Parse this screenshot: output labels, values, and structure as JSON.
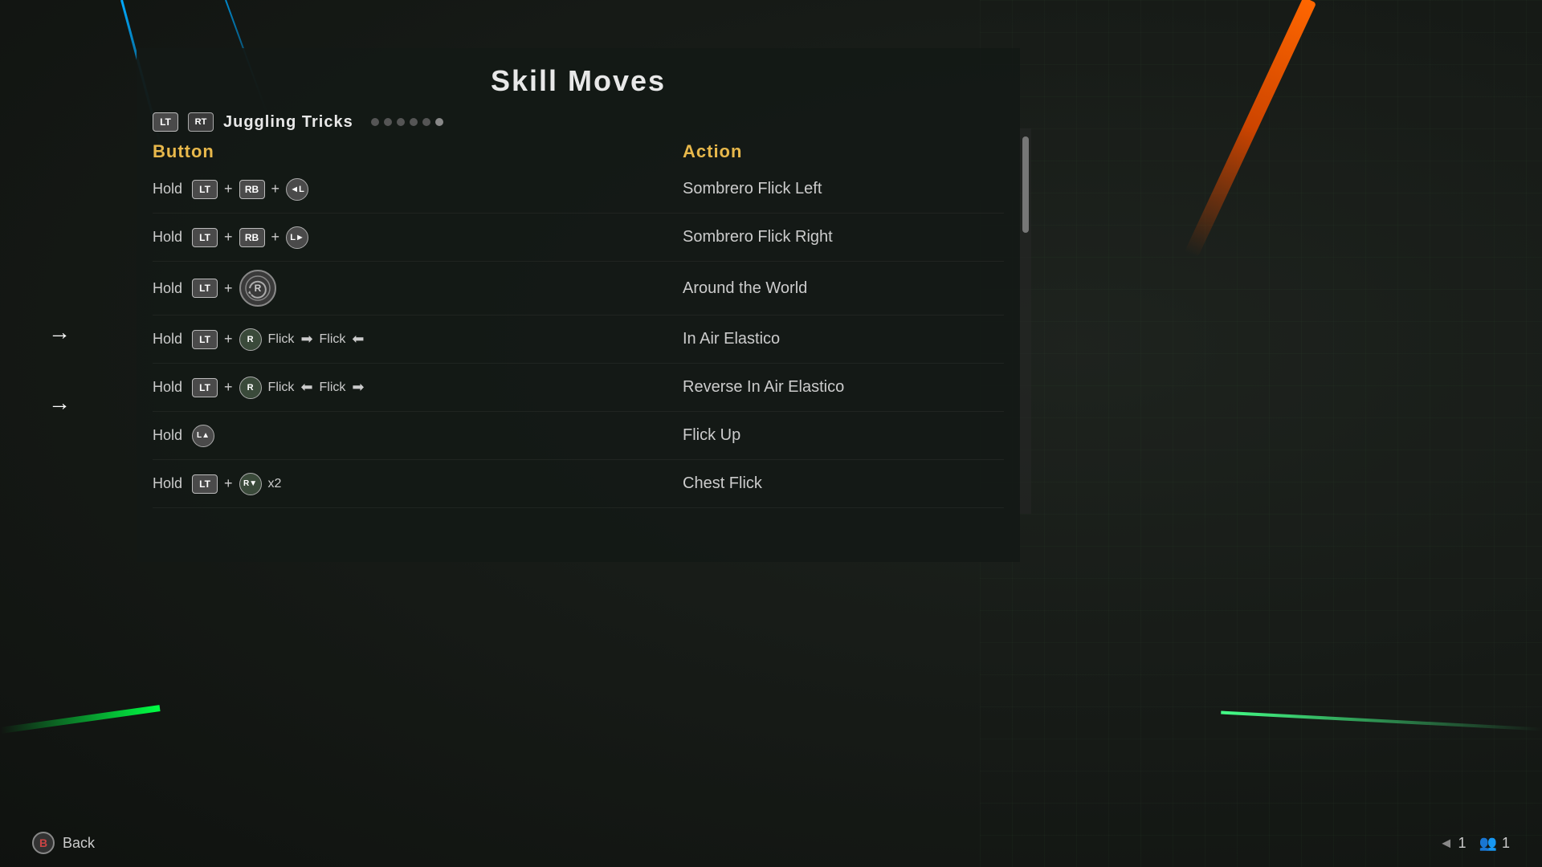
{
  "title": "Skill Moves",
  "category": {
    "lt_label": "LT",
    "rt_label": "RT",
    "name": "Juggling Tricks",
    "dots": [
      1,
      2,
      3,
      4,
      5,
      6
    ],
    "active_dot": 6
  },
  "columns": {
    "button_header": "Button",
    "action_header": "Action"
  },
  "moves": [
    {
      "id": 1,
      "button_desc": "Hold LT + RB + L←",
      "action": "Sombrero Flick Left",
      "has_arrow_left": false
    },
    {
      "id": 2,
      "button_desc": "Hold LT + RB + L→",
      "action": "Sombrero Flick Right",
      "has_arrow_left": false
    },
    {
      "id": 3,
      "button_desc": "Hold LT + R↺",
      "action": "Around the World",
      "has_arrow_left": false
    },
    {
      "id": 4,
      "button_desc": "Hold LT + R Flick → Flick ←",
      "action": "In Air Elastico",
      "has_arrow_left": true
    },
    {
      "id": 5,
      "button_desc": "Hold LT + R Flick ← Flick →",
      "action": "Reverse In Air Elastico",
      "has_arrow_left": true
    },
    {
      "id": 6,
      "button_desc": "Hold L↑",
      "action": "Flick Up",
      "has_arrow_left": false
    },
    {
      "id": 7,
      "button_desc": "Hold LT + R↓ x2",
      "action": "Chest Flick",
      "has_arrow_left": false
    }
  ],
  "bottom": {
    "back_button_label": "B",
    "back_label": "Back",
    "page_number": "1",
    "player_number": "1"
  },
  "colors": {
    "header_gold": "#e8b84b",
    "text_main": "#cccccc",
    "bg_dark": "#1a1f1e"
  }
}
